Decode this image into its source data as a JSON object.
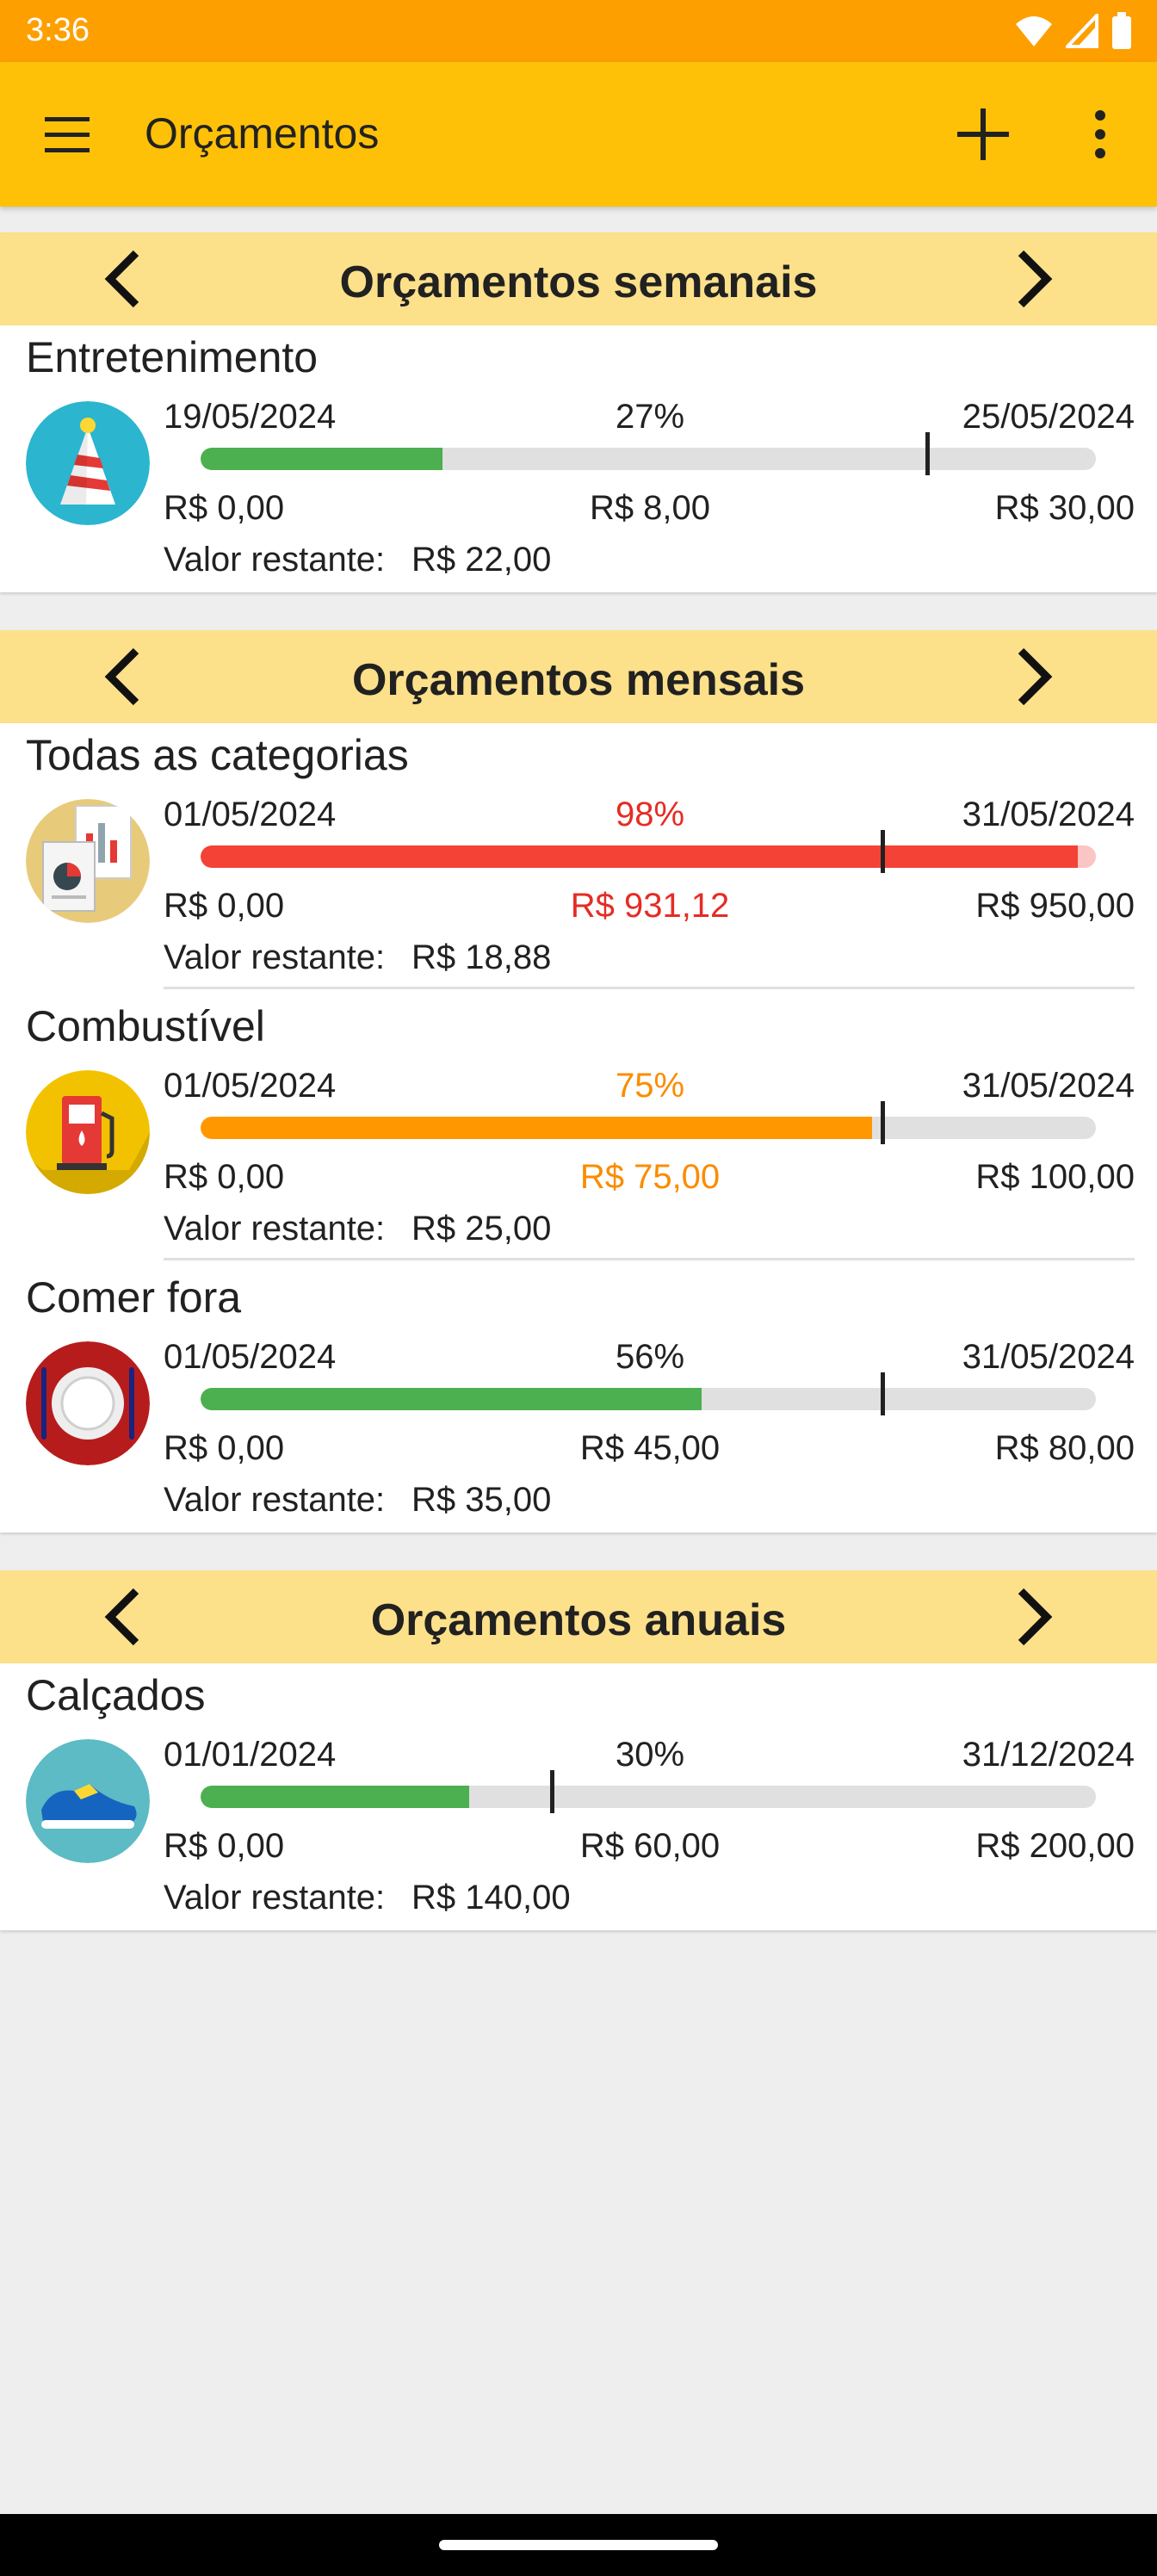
{
  "status_bar": {
    "time": "3:36",
    "icons": [
      "wifi-icon",
      "cell-signal-icon",
      "battery-icon"
    ]
  },
  "app_bar": {
    "title": "Orçamentos",
    "menu_icon": "hamburger-menu-icon",
    "add_icon": "plus-icon",
    "more_icon": "more-vert-icon",
    "background": "#fec107"
  },
  "colors": {
    "green": "#4caf50",
    "red": "#f44336",
    "red_light": "#f9c6c3",
    "orange": "#ff9800",
    "header": "#fde08a"
  },
  "sections": [
    {
      "title": "Orçamentos semanais",
      "items": [
        {
          "name": "Entretenimento",
          "icon": "party-hat-icon",
          "start_date": "19/05/2024",
          "end_date": "25/05/2024",
          "percent": "27%",
          "progress": 0.27,
          "period_elapsed": 0.81,
          "min": "R$ 0,00",
          "spent": "R$ 8,00",
          "max": "R$ 30,00",
          "remaining_label": "Valor restante:",
          "remaining": "R$ 22,00",
          "status": "ok"
        }
      ]
    },
    {
      "title": "Orçamentos mensais",
      "items": [
        {
          "name": "Todas as categorias",
          "icon": "report-documents-icon",
          "start_date": "01/05/2024",
          "end_date": "31/05/2024",
          "percent": "98%",
          "progress": 0.98,
          "period_elapsed": 0.76,
          "min": "R$ 0,00",
          "spent": "R$ 931,12",
          "max": "R$ 950,00",
          "remaining_label": "Valor restante:",
          "remaining": "R$ 18,88",
          "status": "danger"
        },
        {
          "name": "Combustível",
          "icon": "fuel-pump-icon",
          "start_date": "01/05/2024",
          "end_date": "31/05/2024",
          "percent": "75%",
          "progress": 0.75,
          "period_elapsed": 0.76,
          "min": "R$ 0,00",
          "spent": "R$ 75,00",
          "max": "R$ 100,00",
          "remaining_label": "Valor restante:",
          "remaining": "R$ 25,00",
          "status": "warning"
        },
        {
          "name": "Comer fora",
          "icon": "plate-cutlery-icon",
          "start_date": "01/05/2024",
          "end_date": "31/05/2024",
          "percent": "56%",
          "progress": 0.56,
          "period_elapsed": 0.76,
          "min": "R$ 0,00",
          "spent": "R$ 45,00",
          "max": "R$ 80,00",
          "remaining_label": "Valor restante:",
          "remaining": "R$ 35,00",
          "status": "ok"
        }
      ]
    },
    {
      "title": "Orçamentos anuais",
      "items": [
        {
          "name": "Calçados",
          "icon": "sneaker-icon",
          "start_date": "01/01/2024",
          "end_date": "31/12/2024",
          "percent": "30%",
          "progress": 0.3,
          "period_elapsed": 0.39,
          "min": "R$ 0,00",
          "spent": "R$ 60,00",
          "max": "R$ 200,00",
          "remaining_label": "Valor restante:",
          "remaining": "R$ 140,00",
          "status": "ok"
        }
      ]
    }
  ]
}
